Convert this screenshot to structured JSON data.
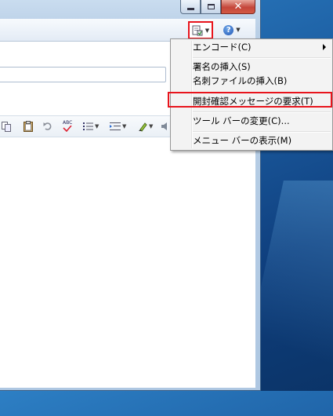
{
  "menu": {
    "items": [
      {
        "label": "エンコード(C)"
      },
      {
        "label": "署名の挿入(S)"
      },
      {
        "label": "名刺ファイルの挿入(B)"
      },
      {
        "label": "開封確認メッセージの要求(T)"
      },
      {
        "label": "ツール バーの変更(C)..."
      },
      {
        "label": "メニュー バーの表示(M)"
      }
    ]
  },
  "format_bar": {
    "spell_icon_text": "ABC"
  },
  "toolbar": {
    "help_glyph": "?"
  },
  "icons": {
    "page": "page-options-icon",
    "help": "help-icon",
    "close": "close-icon",
    "minimize": "minimize-icon",
    "maximize": "maximize-icon"
  },
  "colors": {
    "highlight": "#e8141c",
    "desktop": "#1d5fa3"
  }
}
